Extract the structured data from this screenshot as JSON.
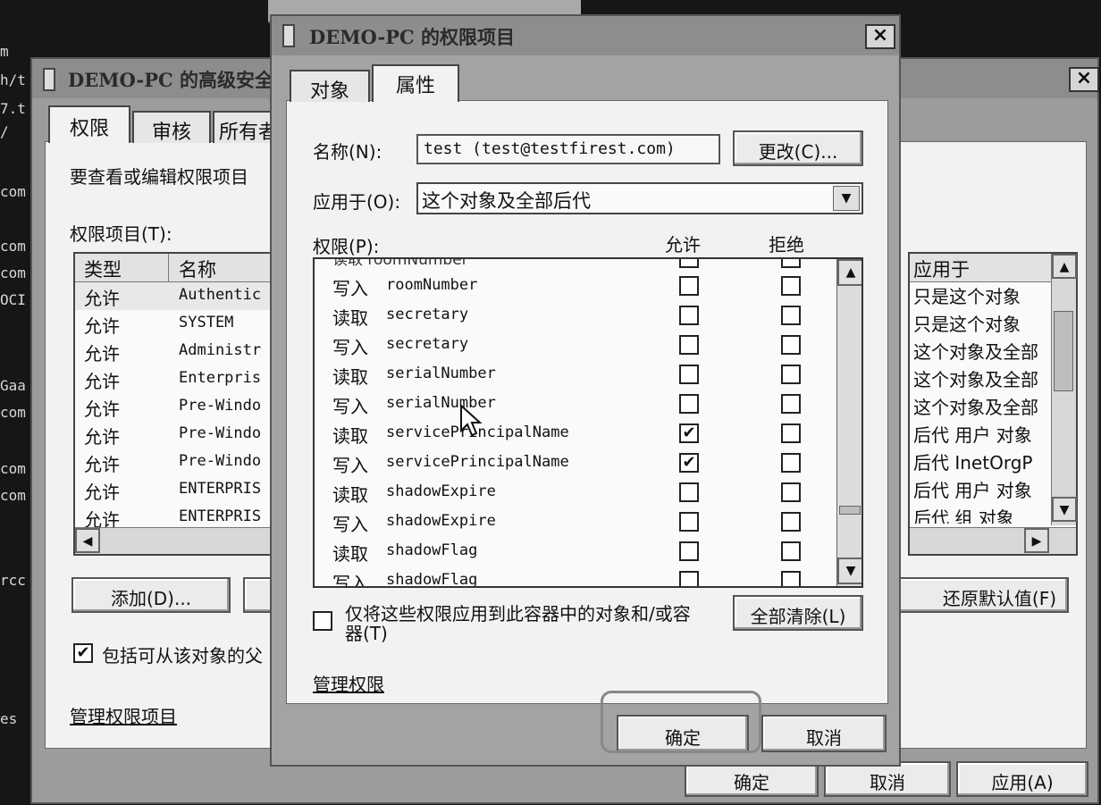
{
  "terminal": {
    "lines": [
      "m",
      "h/t",
      "7.t",
      "/",
      "com",
      "com",
      "com",
      "OCI",
      "Gaa",
      "com",
      "com",
      "com",
      "rcc",
      "es"
    ]
  },
  "bg_window": {
    "title": "DEMO-PC 的高级安全",
    "close": "×",
    "tabs": [
      "权限",
      "审核",
      "所有者"
    ],
    "intro_text": "要查看或编辑权限项目",
    "list_label": "权限项目(T):",
    "columns": [
      "类型",
      "名称"
    ],
    "rows": [
      {
        "type": "允许",
        "name": "Authentic"
      },
      {
        "type": "允许",
        "name": "SYSTEM"
      },
      {
        "type": "允许",
        "name": "Administr"
      },
      {
        "type": "允许",
        "name": "Enterpris"
      },
      {
        "type": "允许",
        "name": "Pre-Windo"
      },
      {
        "type": "允许",
        "name": "Pre-Windo"
      },
      {
        "type": "允许",
        "name": "Pre-Windo"
      },
      {
        "type": "允许",
        "name": "ENTERPRIS"
      },
      {
        "type": "允许",
        "name": "ENTERPRIS"
      }
    ],
    "applies_header": "应用于",
    "applies": [
      "只是这个对象",
      "只是这个对象",
      "这个对象及全部",
      "这个对象及全部",
      "这个对象及全部",
      "后代 用户 对象",
      "后代 InetOrgP",
      "后代 用户 对象",
      "后代 组 对象"
    ],
    "add_button": "添加(D)...",
    "restore_button": "还原默认值(F)",
    "include_checkbox_label": "包括可从该对象的父",
    "include_checked": true,
    "manage_link": "管理权限项目",
    "ok": "确定",
    "cancel": "取消",
    "apply": "应用(A)"
  },
  "fg_window": {
    "title": "DEMO-PC 的权限项目",
    "close": "×",
    "tabs": [
      "对象",
      "属性"
    ],
    "name_label": "名称(N):",
    "name_value": "test (test@testfirest.com)",
    "change_button": "更改(C)...",
    "apply_label": "应用于(O):",
    "apply_value": "这个对象及全部后代",
    "perm_label": "权限(P):",
    "allow_header": "允许",
    "deny_header": "拒绝",
    "partial_top_row": "读取 roomNumber",
    "permissions": [
      {
        "op": "写入",
        "attr": "roomNumber",
        "allow": false,
        "deny": false
      },
      {
        "op": "读取",
        "attr": "secretary",
        "allow": false,
        "deny": false
      },
      {
        "op": "写入",
        "attr": "secretary",
        "allow": false,
        "deny": false
      },
      {
        "op": "读取",
        "attr": "serialNumber",
        "allow": false,
        "deny": false
      },
      {
        "op": "写入",
        "attr": "serialNumber",
        "allow": false,
        "deny": false
      },
      {
        "op": "读取",
        "attr": "servicePrincipalName",
        "allow": true,
        "deny": false
      },
      {
        "op": "写入",
        "attr": "servicePrincipalName",
        "allow": true,
        "deny": false
      },
      {
        "op": "读取",
        "attr": "shadowExpire",
        "allow": false,
        "deny": false
      },
      {
        "op": "写入",
        "attr": "shadowExpire",
        "allow": false,
        "deny": false
      },
      {
        "op": "读取",
        "attr": "shadowFlag",
        "allow": false,
        "deny": false
      },
      {
        "op": "写入",
        "attr": "shadowFlag",
        "allow": false,
        "deny": false
      }
    ],
    "container_checkbox_label": "仅将这些权限应用到此容器中的对象和/或容器(T)",
    "container_checked": false,
    "clear_all_button": "全部清除(L)",
    "manage_link": "管理权限",
    "ok": "确定",
    "cancel": "取消"
  }
}
